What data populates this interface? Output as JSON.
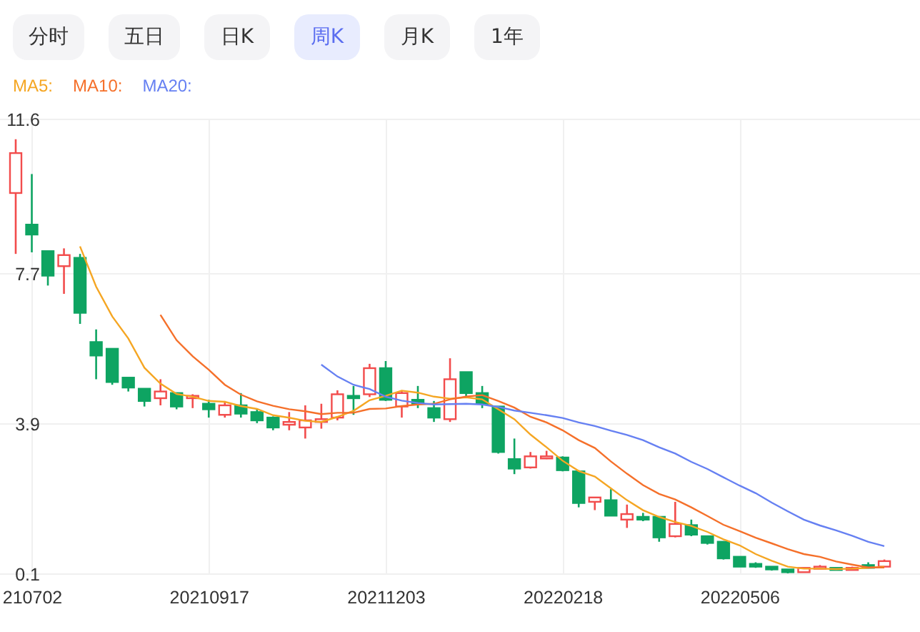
{
  "tabs": [
    {
      "label": "分时",
      "selected": false
    },
    {
      "label": "五日",
      "selected": false
    },
    {
      "label": "日K",
      "selected": false
    },
    {
      "label": "周K",
      "selected": true
    },
    {
      "label": "月K",
      "selected": false
    },
    {
      "label": "1年",
      "selected": false
    }
  ],
  "chart": {
    "chart_data": {
      "type": "candlestick",
      "ylim": [
        0.1,
        11.6
      ],
      "grid": true,
      "yticks": [
        {
          "value": 11.6,
          "label": "11.6"
        },
        {
          "value": 7.7,
          "label": "7.7"
        },
        {
          "value": 3.9,
          "label": "3.9"
        },
        {
          "value": 0.1,
          "label": "0.1"
        }
      ],
      "categories": [
        null,
        "210702",
        null,
        null,
        null,
        null,
        null,
        null,
        null,
        null,
        null,
        null,
        "20210917",
        null,
        null,
        null,
        null,
        null,
        null,
        null,
        null,
        null,
        null,
        "20211203",
        null,
        null,
        null,
        null,
        null,
        null,
        null,
        null,
        null,
        null,
        "20220218",
        null,
        null,
        null,
        null,
        null,
        null,
        null,
        null,
        null,
        null,
        "20220506",
        null,
        null,
        null,
        null,
        null,
        null,
        null,
        null,
        null
      ],
      "ohlc": [
        [
          9.72,
          11.08,
          8.18,
          10.73
        ],
        [
          8.92,
          10.2,
          8.22,
          8.67
        ],
        [
          8.25,
          8.25,
          7.38,
          7.63
        ],
        [
          7.87,
          8.32,
          7.17,
          8.15
        ],
        [
          8.08,
          8.18,
          6.41,
          6.69
        ],
        [
          5.95,
          6.27,
          5.01,
          5.61
        ],
        [
          5.78,
          5.78,
          4.87,
          4.94
        ],
        [
          5.05,
          5.05,
          4.7,
          4.8
        ],
        [
          4.77,
          4.77,
          4.32,
          4.46
        ],
        [
          4.53,
          5.01,
          4.35,
          4.7
        ],
        [
          4.66,
          4.66,
          4.25,
          4.32
        ],
        [
          4.53,
          4.63,
          4.28,
          4.59
        ],
        [
          4.39,
          4.49,
          4.04,
          4.25
        ],
        [
          4.11,
          4.46,
          4.04,
          4.35
        ],
        [
          4.35,
          4.66,
          4.04,
          4.14
        ],
        [
          4.18,
          4.25,
          3.9,
          3.97
        ],
        [
          4.04,
          4.07,
          3.72,
          3.79
        ],
        [
          3.86,
          4.18,
          3.72,
          3.93
        ],
        [
          3.79,
          4.35,
          3.51,
          3.97
        ],
        [
          3.93,
          4.39,
          3.76,
          4.0
        ],
        [
          4.04,
          4.73,
          3.97,
          4.63
        ],
        [
          4.59,
          4.84,
          4.11,
          4.53
        ],
        [
          4.63,
          5.4,
          4.56,
          5.29
        ],
        [
          5.29,
          5.47,
          4.46,
          4.49
        ],
        [
          4.32,
          4.73,
          4.04,
          4.66
        ],
        [
          4.49,
          4.84,
          4.28,
          4.39
        ],
        [
          4.28,
          4.46,
          3.93,
          4.04
        ],
        [
          4.0,
          5.54,
          3.93,
          5.01
        ],
        [
          5.19,
          5.19,
          4.56,
          4.66
        ],
        [
          4.66,
          4.84,
          4.28,
          4.39
        ],
        [
          4.32,
          4.32,
          3.13,
          3.17
        ],
        [
          2.99,
          3.51,
          2.61,
          2.75
        ],
        [
          2.78,
          3.17,
          2.75,
          3.06
        ],
        [
          3.03,
          3.2,
          2.99,
          3.06
        ],
        [
          3.03,
          3.06,
          2.68,
          2.71
        ],
        [
          2.68,
          2.71,
          1.77,
          1.88
        ],
        [
          1.91,
          2.02,
          1.7,
          2.02
        ],
        [
          1.95,
          2.23,
          1.56,
          1.56
        ],
        [
          1.46,
          1.84,
          1.25,
          1.6
        ],
        [
          1.53,
          1.63,
          1.42,
          1.46
        ],
        [
          1.53,
          1.53,
          0.9,
          1.01
        ],
        [
          1.04,
          1.91,
          1.01,
          1.35
        ],
        [
          1.32,
          1.46,
          1.04,
          1.08
        ],
        [
          1.04,
          1.04,
          0.83,
          0.87
        ],
        [
          0.9,
          0.9,
          0.45,
          0.48
        ],
        [
          0.52,
          0.52,
          0.27,
          0.27
        ],
        [
          0.34,
          0.38,
          0.24,
          0.27
        ],
        [
          0.27,
          0.27,
          0.17,
          0.2
        ],
        [
          0.2,
          0.2,
          0.1,
          0.13
        ],
        [
          0.13,
          0.24,
          0.13,
          0.24
        ],
        [
          0.24,
          0.31,
          0.24,
          0.27
        ],
        [
          0.24,
          0.24,
          0.2,
          0.2
        ],
        [
          0.2,
          0.27,
          0.2,
          0.24
        ],
        [
          0.31,
          0.38,
          0.24,
          0.24
        ],
        [
          0.27,
          0.45,
          0.27,
          0.41
        ]
      ],
      "series": [
        {
          "name": "MA5:",
          "type": "line",
          "color": "#f5a623",
          "values": [
            null,
            null,
            null,
            null,
            8.37,
            7.35,
            6.6,
            6.04,
            5.3,
            4.9,
            4.64,
            4.57,
            4.46,
            4.44,
            4.33,
            4.26,
            4.1,
            4.04,
            3.96,
            3.93,
            4.06,
            4.21,
            4.48,
            4.59,
            4.72,
            4.67,
            4.57,
            4.52,
            4.55,
            4.5,
            4.25,
            4.0,
            3.61,
            3.29,
            2.95,
            2.69,
            2.55,
            2.25,
            1.95,
            1.7,
            1.53,
            1.4,
            1.3,
            1.15,
            0.96,
            0.81,
            0.59,
            0.42,
            0.27,
            0.22,
            0.22,
            0.21,
            0.22,
            0.24,
            0.27
          ]
        },
        {
          "name": "MA10:",
          "type": "line",
          "color": "#f5702a",
          "values": [
            null,
            null,
            null,
            null,
            null,
            null,
            null,
            null,
            null,
            6.64,
            6.0,
            5.59,
            5.25,
            4.87,
            4.62,
            4.45,
            4.34,
            4.25,
            4.2,
            4.13,
            4.16,
            4.16,
            4.26,
            4.27,
            4.33,
            4.37,
            4.39,
            4.5,
            4.57,
            4.61,
            4.46,
            4.29,
            4.06,
            3.92,
            3.72,
            3.47,
            3.27,
            2.93,
            2.62,
            2.33,
            2.11,
            1.97,
            1.77,
            1.55,
            1.33,
            1.17,
            1.0,
            0.86,
            0.71,
            0.59,
            0.52,
            0.4,
            0.32,
            0.25,
            0.25
          ]
        },
        {
          "name": "MA20:",
          "type": "line",
          "color": "#6680f2",
          "values": [
            null,
            null,
            null,
            null,
            null,
            null,
            null,
            null,
            null,
            null,
            null,
            null,
            null,
            null,
            null,
            null,
            null,
            null,
            null,
            5.38,
            5.08,
            4.87,
            4.76,
            4.57,
            4.47,
            4.41,
            4.37,
            4.38,
            4.39,
            4.37,
            4.31,
            4.22,
            4.16,
            4.1,
            4.03,
            3.92,
            3.83,
            3.71,
            3.6,
            3.47,
            3.29,
            3.13,
            2.92,
            2.74,
            2.53,
            2.32,
            2.13,
            1.89,
            1.67,
            1.46,
            1.31,
            1.19,
            1.05,
            0.9,
            0.79
          ]
        }
      ]
    }
  }
}
